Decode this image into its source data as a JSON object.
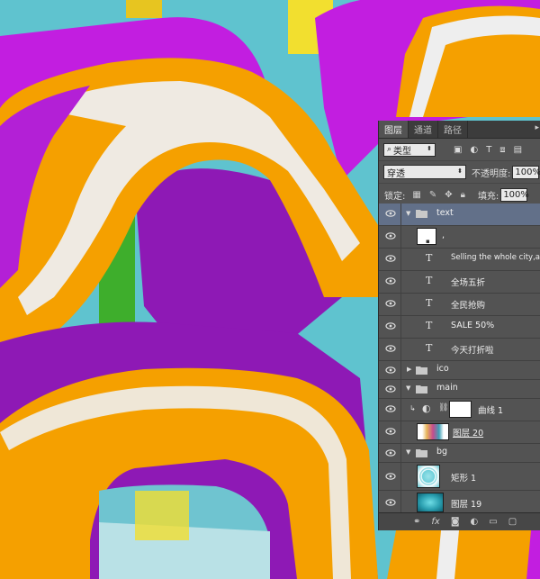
{
  "panel": {
    "tabs": [
      {
        "label": "图层",
        "active": true
      },
      {
        "label": "通道",
        "active": false
      },
      {
        "label": "路径",
        "active": false
      }
    ],
    "filter": {
      "value": "类型",
      "icon": "search-icon"
    },
    "blend": {
      "value": "穿透"
    },
    "opacity": {
      "label": "不透明度:",
      "value": "100%"
    },
    "lock": {
      "label": "锁定:"
    },
    "fill": {
      "label": "填充:",
      "value": "100%"
    },
    "layers": [
      {
        "name": "text",
        "kind": "group",
        "expanded": true,
        "selected": true
      },
      {
        "name": ",",
        "kind": "smart"
      },
      {
        "name": "Selling the whole city,a",
        "kind": "text"
      },
      {
        "name": "全场五折",
        "kind": "text"
      },
      {
        "name": "全民抢购",
        "kind": "text"
      },
      {
        "name": "SALE  50%",
        "kind": "text"
      },
      {
        "name": "今天打折啦",
        "kind": "text"
      },
      {
        "name": "ico",
        "kind": "group",
        "expanded": false
      },
      {
        "name": "main",
        "kind": "group",
        "expanded": true
      },
      {
        "name": "曲线 1",
        "kind": "adjustment"
      },
      {
        "name": "图层 20",
        "kind": "image"
      },
      {
        "name": "bg",
        "kind": "group",
        "expanded": true
      },
      {
        "name": "矩形 1",
        "kind": "shape"
      },
      {
        "name": "图层 19",
        "kind": "image"
      }
    ]
  },
  "colors": {
    "orange": "#f5a000",
    "purple": "#c60fe0",
    "white": "#eeeeee",
    "teal": "#5fc3cf",
    "panel": "#535353",
    "selected": "#627089"
  }
}
